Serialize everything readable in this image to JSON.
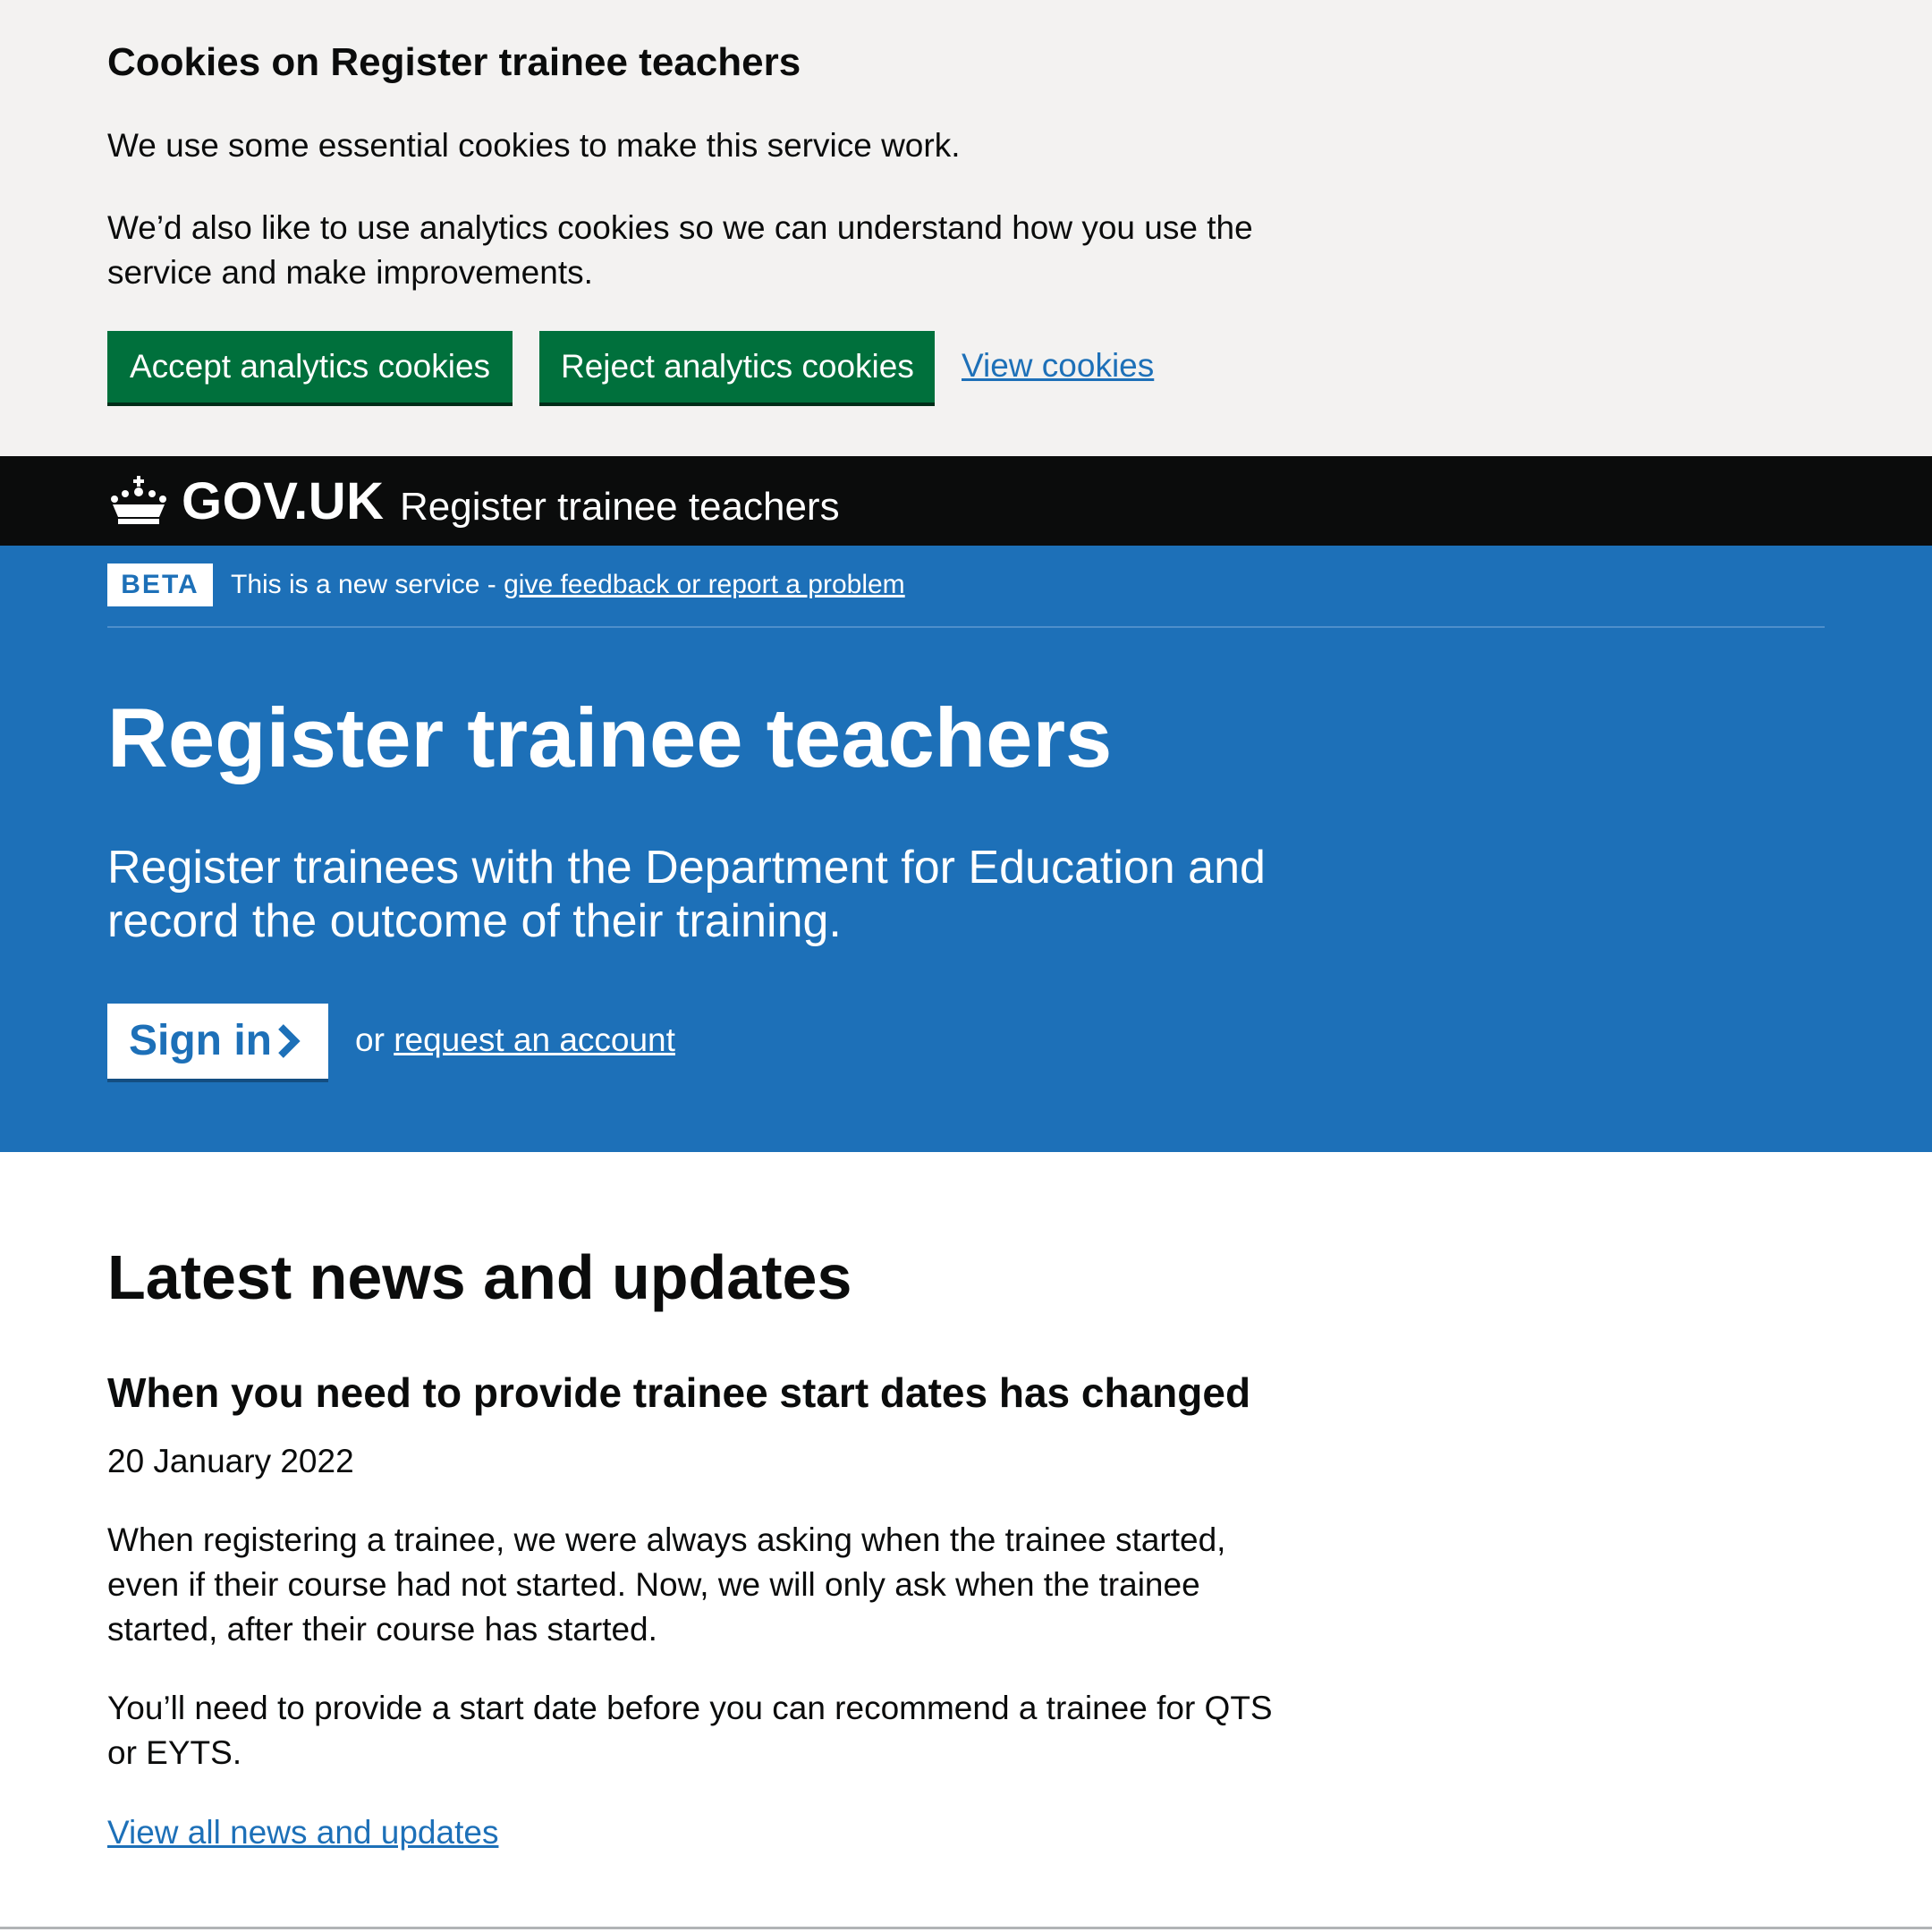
{
  "cookie_banner": {
    "title": "Cookies on Register trainee teachers",
    "essential_text": "We use some essential cookies to make this service work.",
    "analytics_text": "We’d also like to use analytics cookies so we can understand how you use the service and make improvements.",
    "accept_label": "Accept analytics cookies",
    "reject_label": "Reject analytics cookies",
    "view_label": "View cookies"
  },
  "header": {
    "logotype": "GOV.UK",
    "service_name": "Register trainee teachers",
    "logo_icon": "crown-icon"
  },
  "phase_banner": {
    "tag": "BETA",
    "text": "This is a new service - ",
    "link": "give feedback or report a problem"
  },
  "hero": {
    "title": "Register trainee teachers",
    "lead": "Register trainees with the Department for Education and record the outcome of their training.",
    "signin_label": "Sign in",
    "signin_icon": "chevron-right-icon",
    "or_text": "or ",
    "request_link": "request an account"
  },
  "news": {
    "heading": "Latest news and updates",
    "item": {
      "title": "When you need to provide trainee start dates has changed",
      "date": "20 January 2022",
      "paragraphs": [
        "When registering a trainee, we were always asking when the trainee started, even if their course had not started. Now, we will only ask when the trainee started, after their course has started.",
        "You’ll need to provide a start date before you can recommend a trainee for QTS or EYTS."
      ]
    },
    "view_all": "View all news and updates"
  },
  "colors": {
    "green_button": "#00703c",
    "link_blue": "#1d70b8",
    "hero_blue": "#1d70b8",
    "header_black": "#0b0c0c",
    "banner_grey": "#f3f2f1"
  }
}
